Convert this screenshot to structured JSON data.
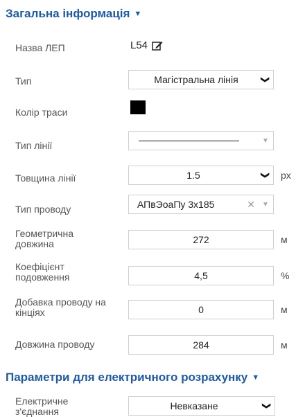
{
  "general": {
    "title": "Загальна інформація",
    "rows": {
      "name": {
        "label": "Назва ЛЕП",
        "value": "L54"
      },
      "type": {
        "label": "Тип",
        "value": "Магістральна лінія"
      },
      "color": {
        "label": "Колір траси",
        "color": "#000000"
      },
      "line_type": {
        "label": "Тип лінії"
      },
      "thickness": {
        "label": "Товщина лінії",
        "value": "1.5",
        "unit": "px"
      },
      "wire_type": {
        "label": "Тип проводу",
        "value": "АПвЭоаПу 3х185"
      },
      "geom_length": {
        "label": "Геометрична довжина",
        "value": "272",
        "unit": "м"
      },
      "extension_coef": {
        "label": "Коефіцієнт подовження",
        "value": "4,5",
        "unit": "%"
      },
      "end_addition": {
        "label": "Добавка проводу на кінціях",
        "value": "0",
        "unit": "м"
      },
      "wire_length": {
        "label": "Довжина проводу",
        "value": "284",
        "unit": "м"
      }
    }
  },
  "electrical": {
    "title": "Параметри для електричного розрахунку",
    "rows": {
      "connection": {
        "label": "Електричне з'єднання",
        "value": "Невказане"
      }
    }
  },
  "colors": {
    "accent": "#1f5aa6",
    "border": "#d0d0d0"
  }
}
